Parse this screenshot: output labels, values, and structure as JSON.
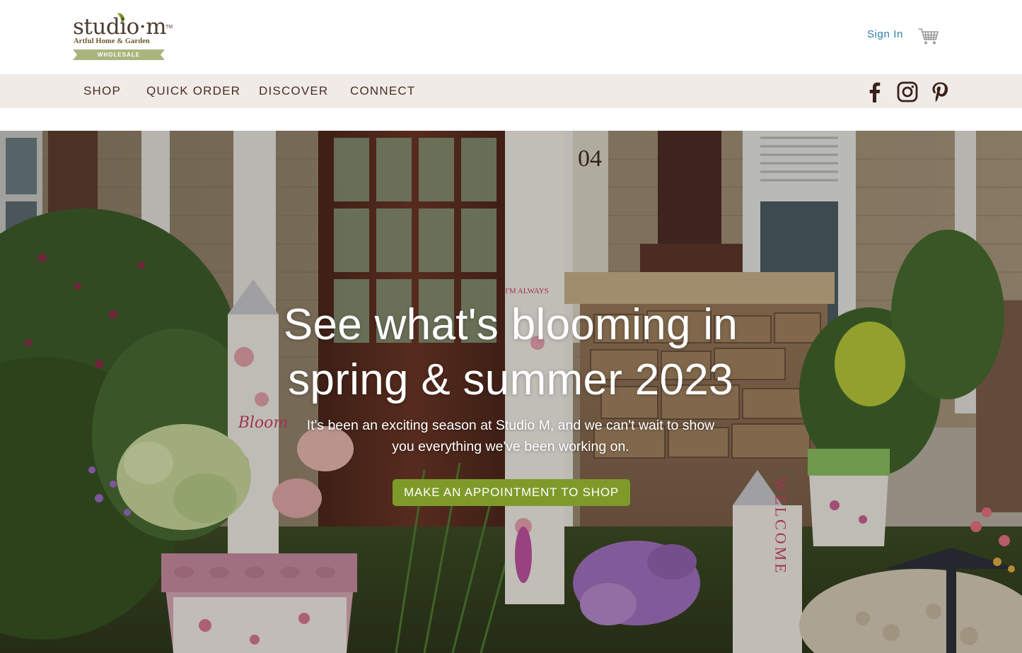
{
  "brand": {
    "logo_name": "studio·m",
    "logo_mark": "TM",
    "logo_tagline": "Artful Home & Garden",
    "logo_ribbon": "WHOLESALE",
    "leaf_color": "#7e9b2a"
  },
  "header": {
    "sign_in_label": "Sign In",
    "cart_icon": "shopping-cart-icon",
    "link_color": "#2f7fa6"
  },
  "nav": {
    "items": [
      {
        "label": "SHOP"
      },
      {
        "label": "QUICK ORDER"
      },
      {
        "label": "DISCOVER"
      },
      {
        "label": "CONNECT"
      }
    ],
    "social": [
      {
        "icon": "facebook-icon"
      },
      {
        "icon": "instagram-icon"
      },
      {
        "icon": "pinterest-icon"
      }
    ],
    "background": "#f0ebe7"
  },
  "hero": {
    "title_line1": "See what's blooming in",
    "title_line2": "spring & summer 2023",
    "subtitle": "It's been an exciting season at Studio M, and we can't wait to show you everything we've been working on.",
    "cta_label": "MAKE AN APPOINTMENT TO SHOP",
    "cta_color": "#7e9b2a",
    "photo_text": {
      "sign_small": "I'M ALWAYS",
      "pot_script": "Bloom",
      "welcome_post": "WELCOME",
      "house_number": "04"
    }
  }
}
